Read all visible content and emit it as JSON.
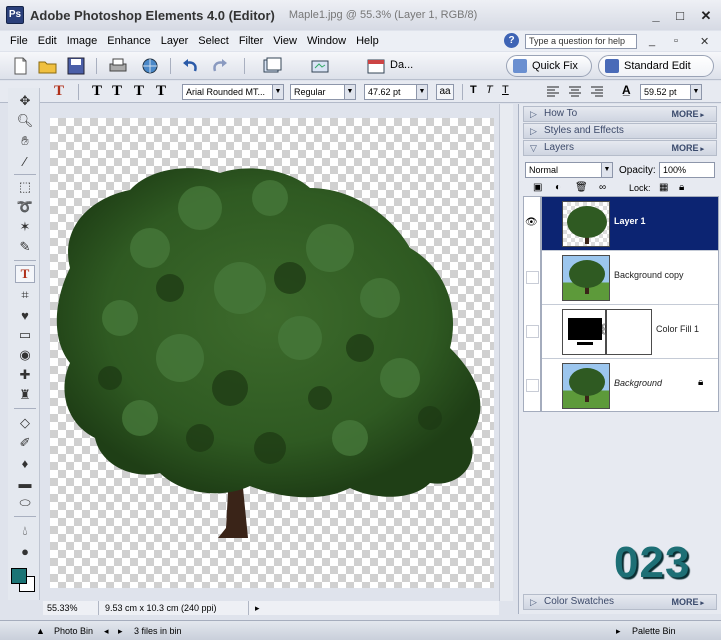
{
  "window": {
    "app_title": "Adobe Photoshop Elements 4.0 (Editor)",
    "doc_title": "Maple1.jpg @ 55.3% (Layer 1, RGB/8)",
    "minimize": "_",
    "maximize": "□",
    "close": "✕"
  },
  "menu": {
    "items": [
      "File",
      "Edit",
      "Image",
      "Enhance",
      "Layer",
      "Select",
      "Filter",
      "View",
      "Window",
      "Help"
    ],
    "help_placeholder": "Type a question for help"
  },
  "shortcuts": {
    "date_label": "Da...",
    "quick_fix": "Quick Fix",
    "standard_edit": "Standard Edit"
  },
  "options": {
    "tool_glyph": "T",
    "type_glyphs": [
      "T",
      "T",
      "T",
      "T"
    ],
    "font_family": "Arial Rounded MT...",
    "font_style": "Regular",
    "font_size": "47.62 pt",
    "aa": "aa",
    "leading": "59.52 pt"
  },
  "tools": {
    "icons": [
      "move-tool-icon",
      "zoom-tool-icon",
      "hand-tool-icon",
      "eyedropper-tool-icon",
      "marquee-tool-icon",
      "lasso-tool-icon",
      "magic-wand-tool-icon",
      "selection-brush-tool-icon",
      "type-tool-icon",
      "crop-tool-icon",
      "cookie-cutter-tool-icon",
      "straighten-tool-icon",
      "red-eye-tool-icon",
      "healing-brush-tool-icon",
      "clone-stamp-tool-icon",
      "eraser-tool-icon",
      "brush-tool-icon",
      "paint-bucket-tool-icon",
      "gradient-tool-icon",
      "shape-tool-icon",
      "blur-tool-icon",
      "sponge-tool-icon"
    ],
    "foreground_color": "#1b7475",
    "background_color": "#ffffff"
  },
  "status": {
    "zoom": "55.33%",
    "dimensions": "9.53 cm x 10.3 cm (240 ppi)"
  },
  "palettes": {
    "how_to": "How To",
    "styles_effects": "Styles and Effects",
    "layers": "Layers",
    "color_swatches": "Color Swatches",
    "more": "MORE",
    "blend_mode": "Normal",
    "opacity_label": "Opacity:",
    "opacity_value": "100%",
    "lock_label": "Lock:",
    "layers_list": [
      {
        "name": "Layer 1",
        "selected": true,
        "visible": true,
        "locked": false
      },
      {
        "name": "Background copy",
        "selected": false,
        "visible": false,
        "locked": false
      },
      {
        "name": "Color Fill 1",
        "selected": false,
        "visible": false,
        "locked": false
      },
      {
        "name": "Background",
        "selected": false,
        "visible": false,
        "locked": true
      }
    ]
  },
  "bottombar": {
    "photo_bin": "Photo Bin",
    "files_in_bin": "3 files in bin",
    "palette_bin": "Palette Bin"
  },
  "overlay_number": "023"
}
